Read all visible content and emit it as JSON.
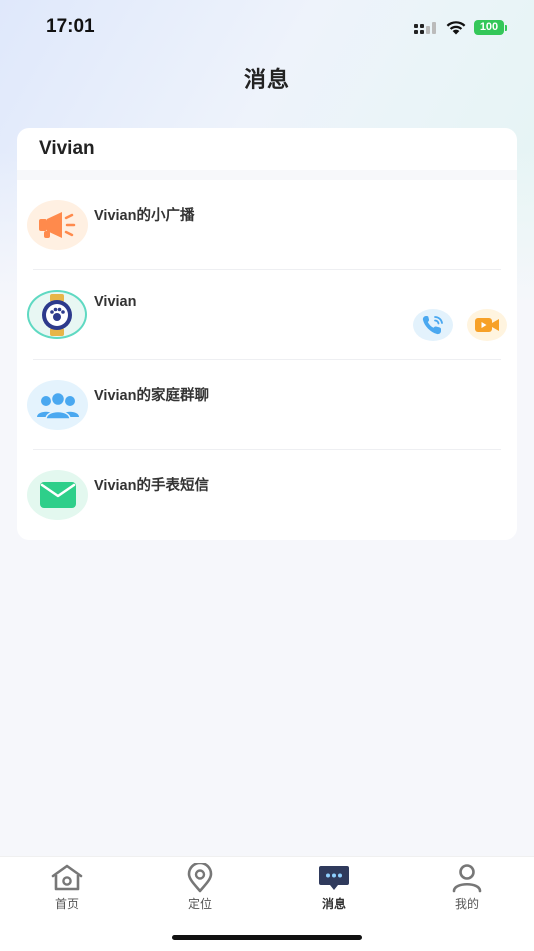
{
  "status_bar": {
    "time": "17:01",
    "battery": "100"
  },
  "page": {
    "title": "消息"
  },
  "card": {
    "header": "Vivian",
    "items": [
      {
        "title": "Vivian的小广播",
        "icon": "megaphone-icon"
      },
      {
        "title": "Vivian",
        "icon": "watch-icon"
      },
      {
        "title": "Vivian的家庭群聊",
        "icon": "group-icon"
      },
      {
        "title": "Vivian的手表短信",
        "icon": "envelope-icon"
      }
    ]
  },
  "tabbar": {
    "tabs": [
      {
        "label": "首页",
        "icon": "home-icon"
      },
      {
        "label": "定位",
        "icon": "location-pin-icon"
      },
      {
        "label": "消息",
        "icon": "chat-bubble-icon",
        "active": true
      },
      {
        "label": "我的",
        "icon": "person-icon"
      }
    ]
  },
  "colors": {
    "accent_orange": "#ff8a4c",
    "accent_blue": "#4aa8f0",
    "accent_green": "#2ecf8a",
    "watch_teal": "#5fd9c2",
    "watch_navy": "#2d3a8c",
    "video_orange": "#f7a128",
    "battery_green": "#34c759"
  }
}
